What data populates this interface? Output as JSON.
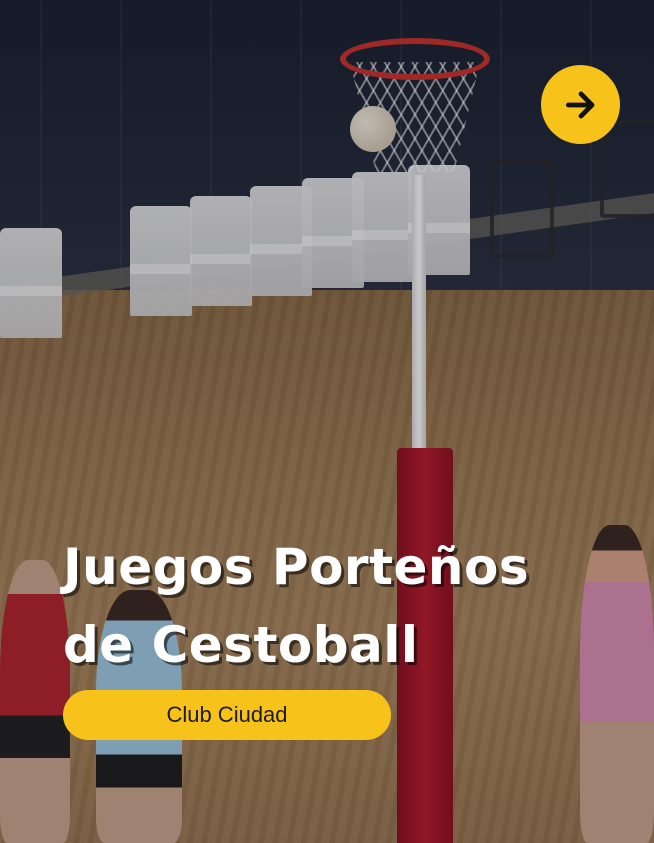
{
  "card": {
    "title_line1": "Juegos Porteños",
    "title_line2": "de Cestoball",
    "badge_label": "Club Ciudad",
    "next_button": {
      "icon": "arrow-right-icon"
    }
  },
  "colors": {
    "accent": "#f7c21a",
    "title_text": "#ffffff",
    "badge_text": "#1c1c1c"
  }
}
